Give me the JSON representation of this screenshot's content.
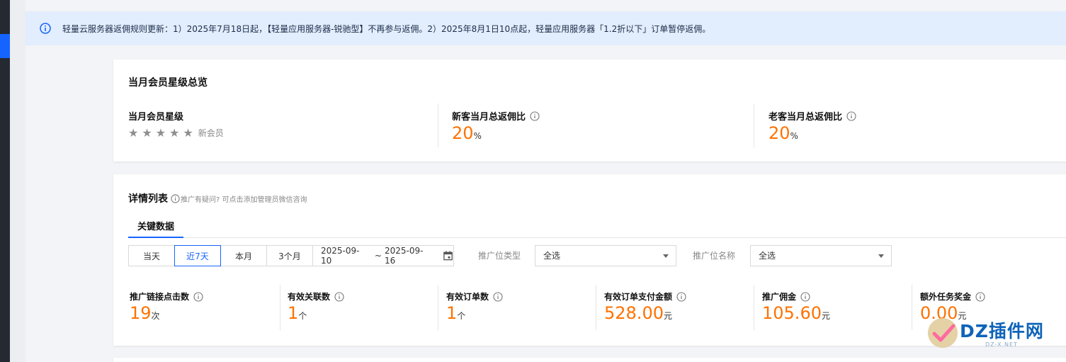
{
  "notice": {
    "icon": "info-icon",
    "text": "轻量云服务器返佣规则更新：1）2025年7月18日起，【轻量应用服务器-锐驰型】不再参与返佣。2）2025年8月1日10点起，轻量应用服务器「1.2折以下」订单暂停返佣。"
  },
  "overview": {
    "title": "当月会员星级总览",
    "star": {
      "label": "当月会员星级",
      "level": "新会员",
      "rating": 0,
      "max": 5
    },
    "new_ratio": {
      "label": "新客当月总返佣比",
      "value": "20",
      "unit": "%"
    },
    "old_ratio": {
      "label": "老客当月总返佣比",
      "value": "20",
      "unit": "%"
    }
  },
  "details": {
    "title": "详情列表",
    "hint": "推广有疑问? 可点击添加管理员微信咨询",
    "tab": "关键数据",
    "ranges": [
      {
        "label": "当天",
        "active": false
      },
      {
        "label": "近7天",
        "active": true
      },
      {
        "label": "本月",
        "active": false
      },
      {
        "label": "3个月",
        "active": false
      }
    ],
    "date_start": "2025-09-10",
    "date_sep": "~",
    "date_end": "2025-09-16",
    "filter_type_label": "推广位类型",
    "filter_type_value": "全选",
    "filter_name_label": "推广位名称",
    "filter_name_value": "全选",
    "metrics": [
      {
        "label": "推广链接点击数",
        "value": "19",
        "unit": "次"
      },
      {
        "label": "有效关联数",
        "value": "1",
        "unit": "个"
      },
      {
        "label": "有效订单数",
        "value": "1",
        "unit": "个"
      },
      {
        "label": "有效订单支付金额",
        "value": "528.00",
        "unit": "元"
      },
      {
        "label": "推广佣金",
        "value": "105.60",
        "unit": "元"
      },
      {
        "label": "额外任务奖金",
        "value": "0.00",
        "unit": "元"
      }
    ]
  },
  "watermark": {
    "text": "DZ插件网",
    "sub": "DZ-X.NET"
  },
  "colors": {
    "accent": "#1664ff",
    "value": "#ff7200",
    "notice_bg": "#e2edfd"
  }
}
